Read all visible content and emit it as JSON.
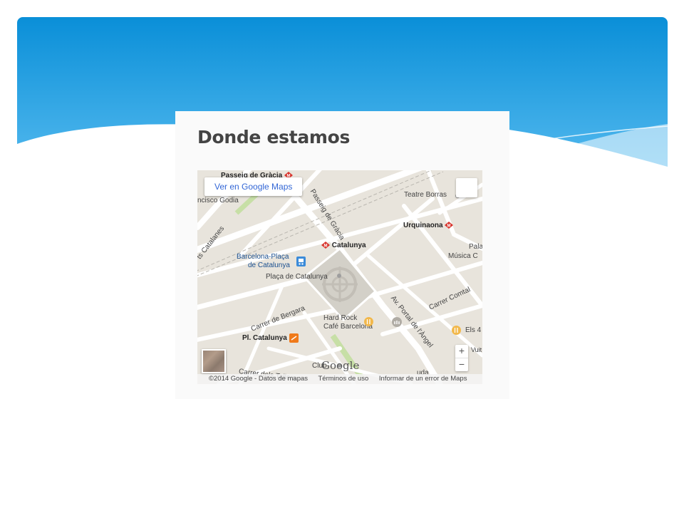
{
  "slide": {
    "banner_colors": {
      "top": "#0a8fd8",
      "bottom": "#5fc0f2",
      "wave": "#ffffff"
    }
  },
  "card": {
    "title": "Donde estamos"
  },
  "map": {
    "view_in_maps_label": "Ver en Google Maps",
    "google_logo_text": "Google",
    "labels": {
      "passeig_gracia_metro": "Passeig de Gràcia",
      "francisco_godia": "ncisco Godia",
      "corts_catalanes": "ts Catalanes",
      "passeig_gracia_street": "Passeig de Gràcia",
      "teatre_borras": "Teatre Borras",
      "urquinaona": "Urquinaona",
      "catalunya_metro": "Catalunya",
      "barcelona_placa_1": "Barcelona-Plaça",
      "barcelona_placa_2": "de Catalunya",
      "placa_catalunya": "Plaça de Catalunya",
      "pala": "Pala",
      "musica_c": "Música C",
      "carrer_comtal": "Carrer Comtal",
      "carrer_bergara": "Carrer de Bergara",
      "av_portal_angel": "Av. Portal de l'Àngel",
      "hard_rock_1": "Hard Rock",
      "hard_rock_2": "Café Barcelona",
      "els_4": "Els 4",
      "pl_catalunya": "Pl. Catalunya",
      "vuit_c": "Vuit c",
      "carrer_tallers": "Carrer dels Tallers",
      "club": "Club",
      "uda": "uda"
    },
    "zoom_in": "+",
    "zoom_out": "−",
    "attribution": {
      "copyright": "©2014 Google - Datos de mapas",
      "terms": "Términos de uso",
      "report": "Informar de un error de Maps"
    },
    "icons": {
      "metro": "metro-icon",
      "train": "train-icon",
      "bus": "bus-icon",
      "restaurant": "restaurant-icon",
      "museum": "museum-icon",
      "poi": "poi-icon"
    },
    "colors": {
      "land": "#e8e4dc",
      "road": "#ffffff",
      "square": "#d3d0c8",
      "metro_red": "#d8332c",
      "bus_orange": "#f07a1a",
      "train_blue": "#3b8bd9"
    }
  }
}
